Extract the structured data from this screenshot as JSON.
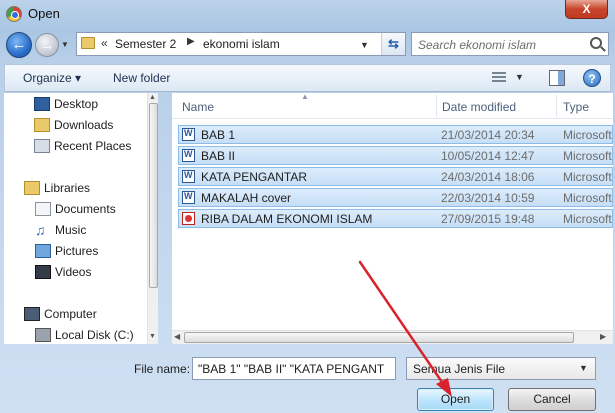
{
  "window": {
    "title": "Open",
    "close_label": "X"
  },
  "address": {
    "chevron": "«",
    "breadcrumbs": [
      "Semester 2",
      "ekonomi islam"
    ],
    "separator": "▶"
  },
  "search": {
    "placeholder": "Search ekonomi islam"
  },
  "toolbar": {
    "organize_label": "Organize ▾",
    "new_folder_label": "New folder",
    "help_label": "?"
  },
  "sidebar": {
    "items": [
      {
        "label": "Desktop",
        "icon": "desktop-icon"
      },
      {
        "label": "Downloads",
        "icon": "downloads-icon"
      },
      {
        "label": "Recent Places",
        "icon": "recent-places-icon"
      },
      {
        "label": "Libraries",
        "icon": "libraries-icon"
      },
      {
        "label": "Documents",
        "icon": "documents-icon"
      },
      {
        "label": "Music",
        "icon": "music-icon"
      },
      {
        "label": "Pictures",
        "icon": "pictures-icon"
      },
      {
        "label": "Videos",
        "icon": "videos-icon"
      },
      {
        "label": "Computer",
        "icon": "computer-icon"
      },
      {
        "label": "Local Disk (C:)",
        "icon": "disk-icon"
      }
    ]
  },
  "file_list": {
    "columns": [
      "Name",
      "Date modified",
      "Type"
    ],
    "rows": [
      {
        "name": "BAB 1",
        "date": "21/03/2014 20:34",
        "type": "Microsoft",
        "icon": "word-doc-icon"
      },
      {
        "name": "BAB II",
        "date": "10/05/2014 12:47",
        "type": "Microsoft",
        "icon": "word-doc-icon"
      },
      {
        "name": "KATA PENGANTAR",
        "date": "24/03/2014 18:06",
        "type": "Microsoft",
        "icon": "word-doc-icon"
      },
      {
        "name": "MAKALAH cover",
        "date": "22/03/2014 10:59",
        "type": "Microsoft",
        "icon": "word-doc-icon"
      },
      {
        "name": "RIBA DALAM EKONOMI ISLAM",
        "date": "27/09/2015 19:48",
        "type": "Microsoft",
        "icon": "pdf-doc-icon"
      }
    ]
  },
  "footer": {
    "file_name_label": "File name:",
    "file_name_value": "\"BAB 1\" \"BAB II\" \"KATA PENGANT",
    "file_type_value": "Semua Jenis File",
    "open_label": "Open",
    "cancel_label": "Cancel"
  },
  "colors": {
    "annotation_arrow": "#d8242a",
    "selection": "#c6def6"
  }
}
